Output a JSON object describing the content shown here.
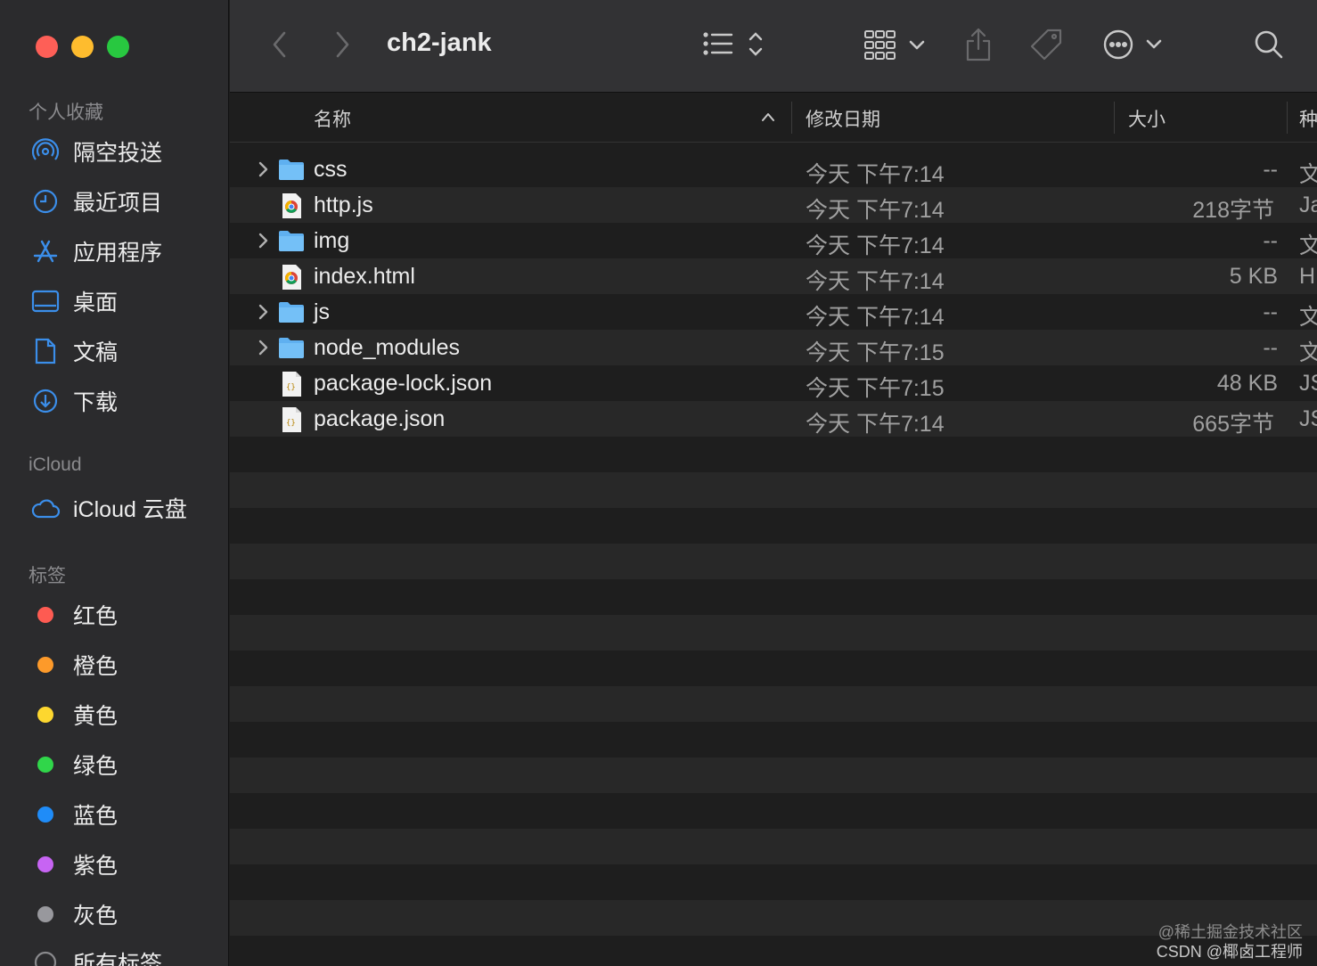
{
  "window": {
    "title": "ch2-jank"
  },
  "sidebar": {
    "favorites_title": "个人收藏",
    "favorites": [
      {
        "label": "隔空投送",
        "icon": "airdrop-icon"
      },
      {
        "label": "最近项目",
        "icon": "clock-icon"
      },
      {
        "label": "应用程序",
        "icon": "applications-icon"
      },
      {
        "label": "桌面",
        "icon": "desktop-icon"
      },
      {
        "label": "文稿",
        "icon": "document-icon"
      },
      {
        "label": "下载",
        "icon": "download-icon"
      }
    ],
    "icloud_title": "iCloud",
    "icloud": [
      {
        "label": "iCloud 云盘",
        "icon": "cloud-icon"
      }
    ],
    "tags_title": "标签",
    "tags": [
      {
        "label": "红色",
        "color": "#fe5b52"
      },
      {
        "label": "橙色",
        "color": "#fd9a2a"
      },
      {
        "label": "黄色",
        "color": "#fdd72f"
      },
      {
        "label": "绿色",
        "color": "#30d64a"
      },
      {
        "label": "蓝色",
        "color": "#1f8cf8"
      },
      {
        "label": "紫色",
        "color": "#c764f3"
      },
      {
        "label": "灰色",
        "color": "#98989d"
      },
      {
        "label": "所有标签",
        "color": ""
      }
    ]
  },
  "columns": {
    "name": "名称",
    "date": "修改日期",
    "size": "大小",
    "kind": "种"
  },
  "files": [
    {
      "name": "css",
      "type": "folder",
      "date": "今天 下午7:14",
      "size": "--",
      "kind": "文"
    },
    {
      "name": "http.js",
      "type": "chrome",
      "date": "今天 下午7:14",
      "size": "218字节",
      "kind": "Ja"
    },
    {
      "name": "img",
      "type": "folder",
      "date": "今天 下午7:14",
      "size": "--",
      "kind": "文"
    },
    {
      "name": "index.html",
      "type": "chrome",
      "date": "今天 下午7:14",
      "size": "5 KB",
      "kind": "H"
    },
    {
      "name": "js",
      "type": "folder",
      "date": "今天 下午7:14",
      "size": "--",
      "kind": "文"
    },
    {
      "name": "node_modules",
      "type": "folder",
      "date": "今天 下午7:15",
      "size": "--",
      "kind": "文"
    },
    {
      "name": "package-lock.json",
      "type": "json",
      "date": "今天 下午7:15",
      "size": "48 KB",
      "kind": "JS"
    },
    {
      "name": "package.json",
      "type": "json",
      "date": "今天 下午7:14",
      "size": "665字节",
      "kind": "JS"
    }
  ],
  "watermark": {
    "line1": "@稀土掘金技术社区",
    "line2": "CSDN @椰卤工程师"
  },
  "colors": {
    "accent": "#3b8eea",
    "folder": "#5fb0f0"
  }
}
